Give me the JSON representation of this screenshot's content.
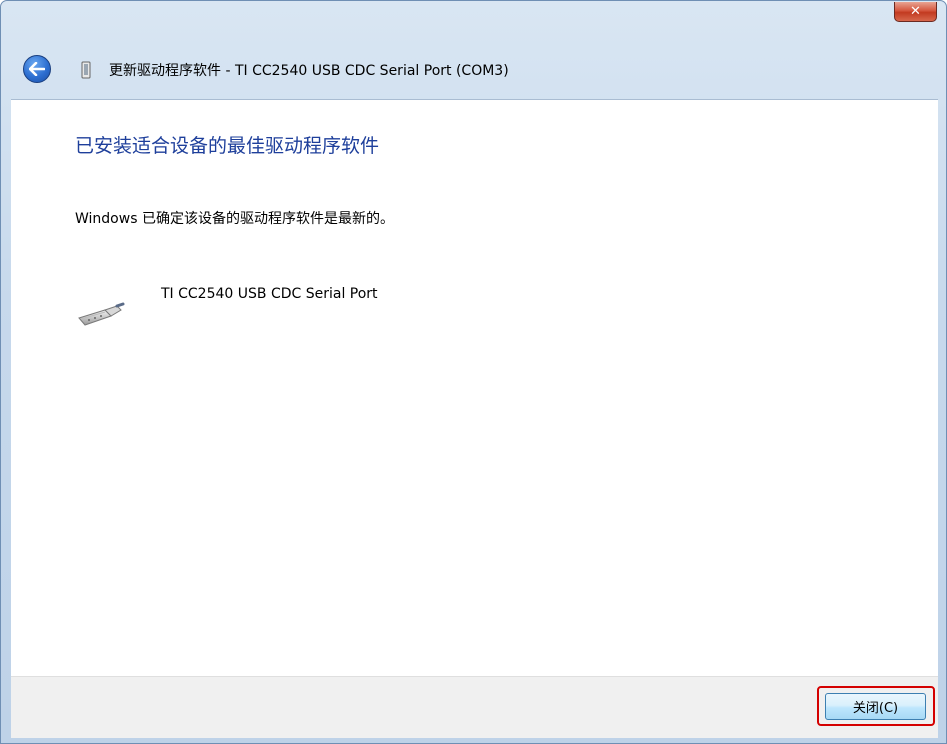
{
  "window": {
    "title": "更新驱动程序软件 - TI CC2540 USB CDC Serial Port (COM3)",
    "close_glyph": "✕"
  },
  "content": {
    "heading": "已安装适合设备的最佳驱动程序软件",
    "message": "Windows 已确定该设备的驱动程序软件是最新的。",
    "device_name": "TI CC2540 USB CDC Serial Port",
    "device_icon": "serial-port-icon"
  },
  "footer": {
    "close_label": "关闭(C)"
  },
  "colors": {
    "heading": "#1e3f9b",
    "highlight": "#d40000"
  }
}
